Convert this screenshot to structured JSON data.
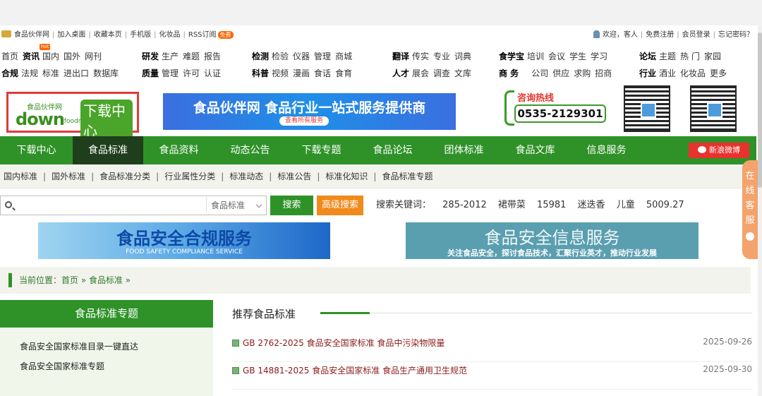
{
  "topbar": {
    "left": [
      "食品伙伴网",
      "加入桌面",
      "收藏本页",
      "手机版",
      "化妆品",
      "RSS订阅"
    ],
    "free_badge": "免费",
    "hot_badge": "hot",
    "right": [
      "欢迎，客人",
      "免费注册",
      "会员登录",
      "忘记密码？"
    ]
  },
  "nav_groups": [
    {
      "row1": [
        "首页",
        "资讯",
        "国内",
        "国外",
        "网刊"
      ],
      "row2": [
        "合规",
        "法规",
        "标准",
        "进出口",
        "数据库"
      ]
    },
    {
      "row1": [
        "研发",
        "生产",
        "难题",
        "报告"
      ],
      "row2": [
        "质量",
        "管理",
        "许可",
        "认证"
      ]
    },
    {
      "row1": [
        "检测",
        "检验",
        "仪器",
        "管理",
        "商城"
      ],
      "row2": [
        "科普",
        "视频",
        "漫画",
        "食话",
        "食育"
      ]
    },
    {
      "row1": [
        "翻译",
        "传实",
        "专业",
        "词典"
      ],
      "row2": [
        "人才",
        "展会",
        "调查",
        "文库"
      ]
    },
    {
      "row1": [
        "食学宝",
        "培训",
        "会议",
        "学生",
        "学习"
      ],
      "row2": [
        "商 务",
        "公司",
        "供应",
        "求购",
        "招商"
      ]
    },
    {
      "row1": [
        "论坛",
        "主题",
        "热 门",
        "家园"
      ],
      "row2": [
        "行业",
        "酒业",
        "化妆品",
        "更多"
      ]
    }
  ],
  "logo": {
    "top": "食品伙伴网",
    "main": "down",
    "sub": ".foodmate.net",
    "badge": "下载中心"
  },
  "banner_main": {
    "title": "食品伙伴网 食品行业一站式服务提供商",
    "cta": "查看所有服务"
  },
  "hotline": {
    "label": "咨询热线",
    "number": "0535-2129301"
  },
  "main_nav": [
    "下载中心",
    "食品标准",
    "食品资料",
    "动态公告",
    "下载专题",
    "食品论坛",
    "团体标准",
    "食品文库",
    "信息服务"
  ],
  "main_nav_active": "食品标准",
  "weibo_label": "新浪微博",
  "sub_nav": [
    "国内标准",
    "国外标准",
    "食品标准分类",
    "行业属性分类",
    "标准动态",
    "标准公告",
    "标准化知识",
    "食品标准专题"
  ],
  "search": {
    "placeholder": "",
    "category": "食品标准",
    "button": "搜索",
    "advanced": "高级搜索"
  },
  "keywords_label": "搜索关键词：",
  "keywords": [
    "285-2012",
    "裙带菜",
    "15981",
    "迷迭香",
    "儿童",
    "5009.27"
  ],
  "banner_a": {
    "title": "食品安全合规服务",
    "sub": "FOOD SAFETY COMPLIANCE SERVICE"
  },
  "banner_b": {
    "title": "食品安全信息服务",
    "sub": "关注食品安全，探讨食品技术，汇聚行业英才，推动行业发展"
  },
  "breadcrumb": "当前位置：首页 » 食品标准 »",
  "sidebar": {
    "title": "食品标准专题",
    "items": [
      "食品安全国家标准目录一键直达",
      "食品安全国家标准专题"
    ]
  },
  "recommend": {
    "title": "推荐食品标准",
    "items": [
      {
        "title": "GB 2762-2025 食品安全国家标准 食品中污染物限量",
        "date": "2025-09-26"
      },
      {
        "title": "GB 14881-2025 食品安全国家标准 食品生产通用卫生规范",
        "date": "2025-09-30"
      }
    ]
  },
  "kefu": "在线客服",
  "colors": {
    "brand_green": "#2f9228",
    "active_nav": "#1f3f1c",
    "orange": "#f08a1c",
    "title_red": "#8b1b1b"
  }
}
